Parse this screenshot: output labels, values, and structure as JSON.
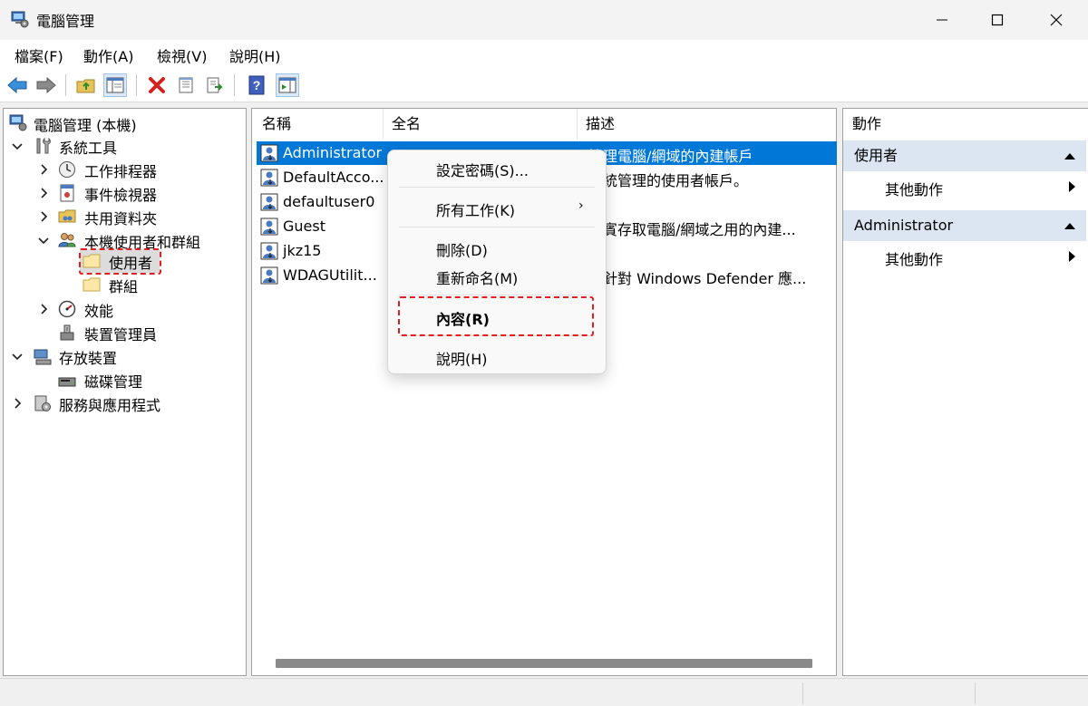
{
  "window": {
    "title": "電腦管理"
  },
  "menu": [
    "檔案(F)",
    "動作(A)",
    "檢視(V)",
    "說明(H)"
  ],
  "tree": {
    "root": "電腦管理 (本機)",
    "system_tools": "系統工具",
    "task_scheduler": "工作排程器",
    "event_viewer": "事件檢視器",
    "shared_folders": "共用資料夾",
    "local_users_groups": "本機使用者和群組",
    "users": "使用者",
    "groups": "群組",
    "performance": "效能",
    "device_manager": "裝置管理員",
    "storage": "存放裝置",
    "disk_management": "磁碟管理",
    "services_apps": "服務與應用程式"
  },
  "list": {
    "columns": [
      "名稱",
      "全名",
      "描述"
    ],
    "rows": [
      {
        "name": "Administrator",
        "desc": "管理電腦/網域的內建帳戶"
      },
      {
        "name": "DefaultAcco...",
        "desc": "系統管理的使用者帳戶。"
      },
      {
        "name": "defaultuser0",
        "desc": ""
      },
      {
        "name": "Guest",
        "desc": "來賓存取電腦/網域之用的內建..."
      },
      {
        "name": "jkz15",
        "desc": ""
      },
      {
        "name": "WDAGUtilit...",
        "desc": "統針對 Windows Defender 應..."
      }
    ]
  },
  "context_menu": {
    "set_password": "設定密碼(S)...",
    "all_tasks": "所有工作(K)",
    "all_tasks_arrow": "›",
    "delete": "刪除(D)",
    "rename": "重新命名(M)",
    "properties": "內容(R)",
    "help": "說明(H)"
  },
  "actions": {
    "header": "動作",
    "section1": "使用者",
    "section1_item": "其他動作",
    "section2": "Administrator",
    "section2_item": "其他動作"
  },
  "colors": {
    "selection": "#0078d7",
    "highlight": "#e02020",
    "section_bg": "#dbe6f2"
  }
}
